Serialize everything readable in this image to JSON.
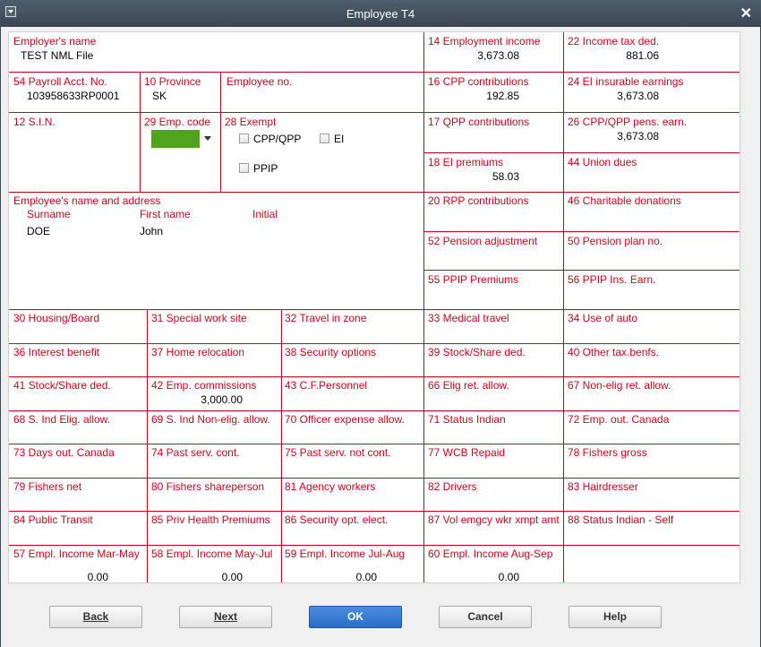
{
  "window": {
    "title": "Employee T4"
  },
  "employer": {
    "name_label": "Employer's name",
    "name": "TEST NML File"
  },
  "payroll": {
    "label": "54 Payroll Acct. No.",
    "value": "103958633RP0001"
  },
  "province": {
    "label": "10 Province",
    "value": "SK"
  },
  "employee_no": {
    "label": "Employee no."
  },
  "sin": {
    "label": "12 S.I.N."
  },
  "emp_code": {
    "label": "29 Emp. code"
  },
  "exempt": {
    "label": "28 Exempt",
    "cpp_qpp": "CPP/QPP",
    "ei": "EI",
    "ppip": "PPIP"
  },
  "employee": {
    "header": "Employee's name and address",
    "surname_label": "Surname",
    "first_label": "First name",
    "initial_label": "Initial",
    "surname": "DOE",
    "first_name": "John"
  },
  "boxes": {
    "b14": {
      "label": "14 Employment income",
      "value": "3,673.08"
    },
    "b22": {
      "label": "22 Income tax ded.",
      "value": "881.06"
    },
    "b16": {
      "label": "16 CPP contributions",
      "value": "192.85"
    },
    "b24": {
      "label": "24 EI insurable earnings",
      "value": "3,673.08"
    },
    "b17": {
      "label": "17 QPP contributions"
    },
    "b26": {
      "label": "26 CPP/QPP pens. earn.",
      "value": "3,673.08"
    },
    "b18": {
      "label": "18 EI premiums",
      "value": "58.03"
    },
    "b44": {
      "label": "44 Union dues"
    },
    "b20": {
      "label": "20 RPP contributions"
    },
    "b46": {
      "label": "46 Charitable donations"
    },
    "b52": {
      "label": "52 Pension adjustment"
    },
    "b50": {
      "label": "50 Pension plan no."
    },
    "b55": {
      "label": "55 PPIP Premiums"
    },
    "b56": {
      "label": "56 PPIP Ins. Earn."
    }
  },
  "grid": [
    [
      "30 Housing/Board",
      "31 Special work site",
      "32 Travel in zone",
      "33 Medical travel",
      "34 Use of auto"
    ],
    [
      "36 Interest benefit",
      "37 Home relocation",
      "38 Security options",
      "39 Stock/Share ded.",
      "40 Other tax.benfs."
    ],
    [
      "41 Stock/Share ded.",
      "42 Emp. commissions",
      "43 C.F.Personnel",
      "66 Elig ret. allow.",
      "67 Non-elig ret. allow."
    ],
    [
      "68 S. Ind Elig. allow.",
      "69 S. Ind Non-elig. allow.",
      "70 Officer expense allow.",
      "71 Status Indian",
      "72 Emp. out. Canada"
    ],
    [
      "73 Days out. Canada",
      "74 Past serv. cont.",
      "75 Past serv. not cont.",
      "77 WCB Repaid",
      "78 Fishers gross"
    ],
    [
      "79 Fishers net",
      "80 Fishers shareperson",
      "81 Agency workers",
      "82 Drivers",
      "83 Hairdresser"
    ],
    [
      "84 Public Transit",
      "85 Priv Health Premiums",
      "86 Security opt. elect.",
      "87 Vol emgcy wkr xmpt amt",
      "88 Status Indian - Self"
    ],
    [
      "57 Empl. Income Mar-May",
      "58 Empl. Income May-Jul",
      "59 Empl. Income Jul-Aug",
      "60 Empl. Income Aug-Sep",
      ""
    ]
  ],
  "grid_values": {
    "b42": "3,000.00",
    "b57": "0.00",
    "b58": "0.00",
    "b59": "0.00",
    "b60": "0.00"
  },
  "buttons": {
    "back": "Back",
    "next": "Next",
    "ok": "OK",
    "cancel": "Cancel",
    "help": "Help"
  }
}
